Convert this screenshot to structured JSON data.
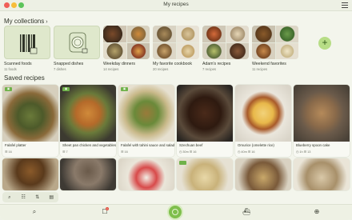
{
  "window": {
    "title": "My recipes"
  },
  "collections": {
    "heading": "My collections",
    "items": [
      {
        "name": "Scanned foods",
        "count": "11 foods"
      },
      {
        "name": "Snapped dishes",
        "count": "7 dishes"
      },
      {
        "name": "Weekday dinners",
        "count": "14 recipes"
      },
      {
        "name": "My favorite cookbook",
        "count": "20 recipes"
      },
      {
        "name": "Adam's recipes",
        "count": "7 recipes"
      },
      {
        "name": "Weekend favorites",
        "count": "11 recipes"
      }
    ]
  },
  "saved": {
    "heading": "Saved recipes",
    "cards": [
      {
        "title": "Falafel platter",
        "meta": "☰ 16",
        "badge": "▣"
      },
      {
        "title": "Sheet pan chicken and vegetables",
        "meta": "☰ 7",
        "badge": "▣"
      },
      {
        "title": "Falafel with tahini sauce and salad",
        "meta": "☰ 16",
        "badge": "▣"
      },
      {
        "title": "Szechuan beef",
        "meta": "◷ 30m  ☰ 16",
        "badge": ""
      },
      {
        "title": "Omurice (omelette rice)",
        "meta": "◷ 40m  ☰ 16",
        "badge": ""
      },
      {
        "title": "Blueberry spoon cake",
        "meta": "◷ 1h  ☰ 13",
        "badge": ""
      }
    ]
  },
  "toolbar": {
    "search": "⌕",
    "filter": "☷",
    "sort": "⇅",
    "view": "▤"
  },
  "bottom_nav": {
    "search": "⌕",
    "cart": "☐",
    "cart_count": "1",
    "basket": "⛴",
    "add": "⊕"
  }
}
